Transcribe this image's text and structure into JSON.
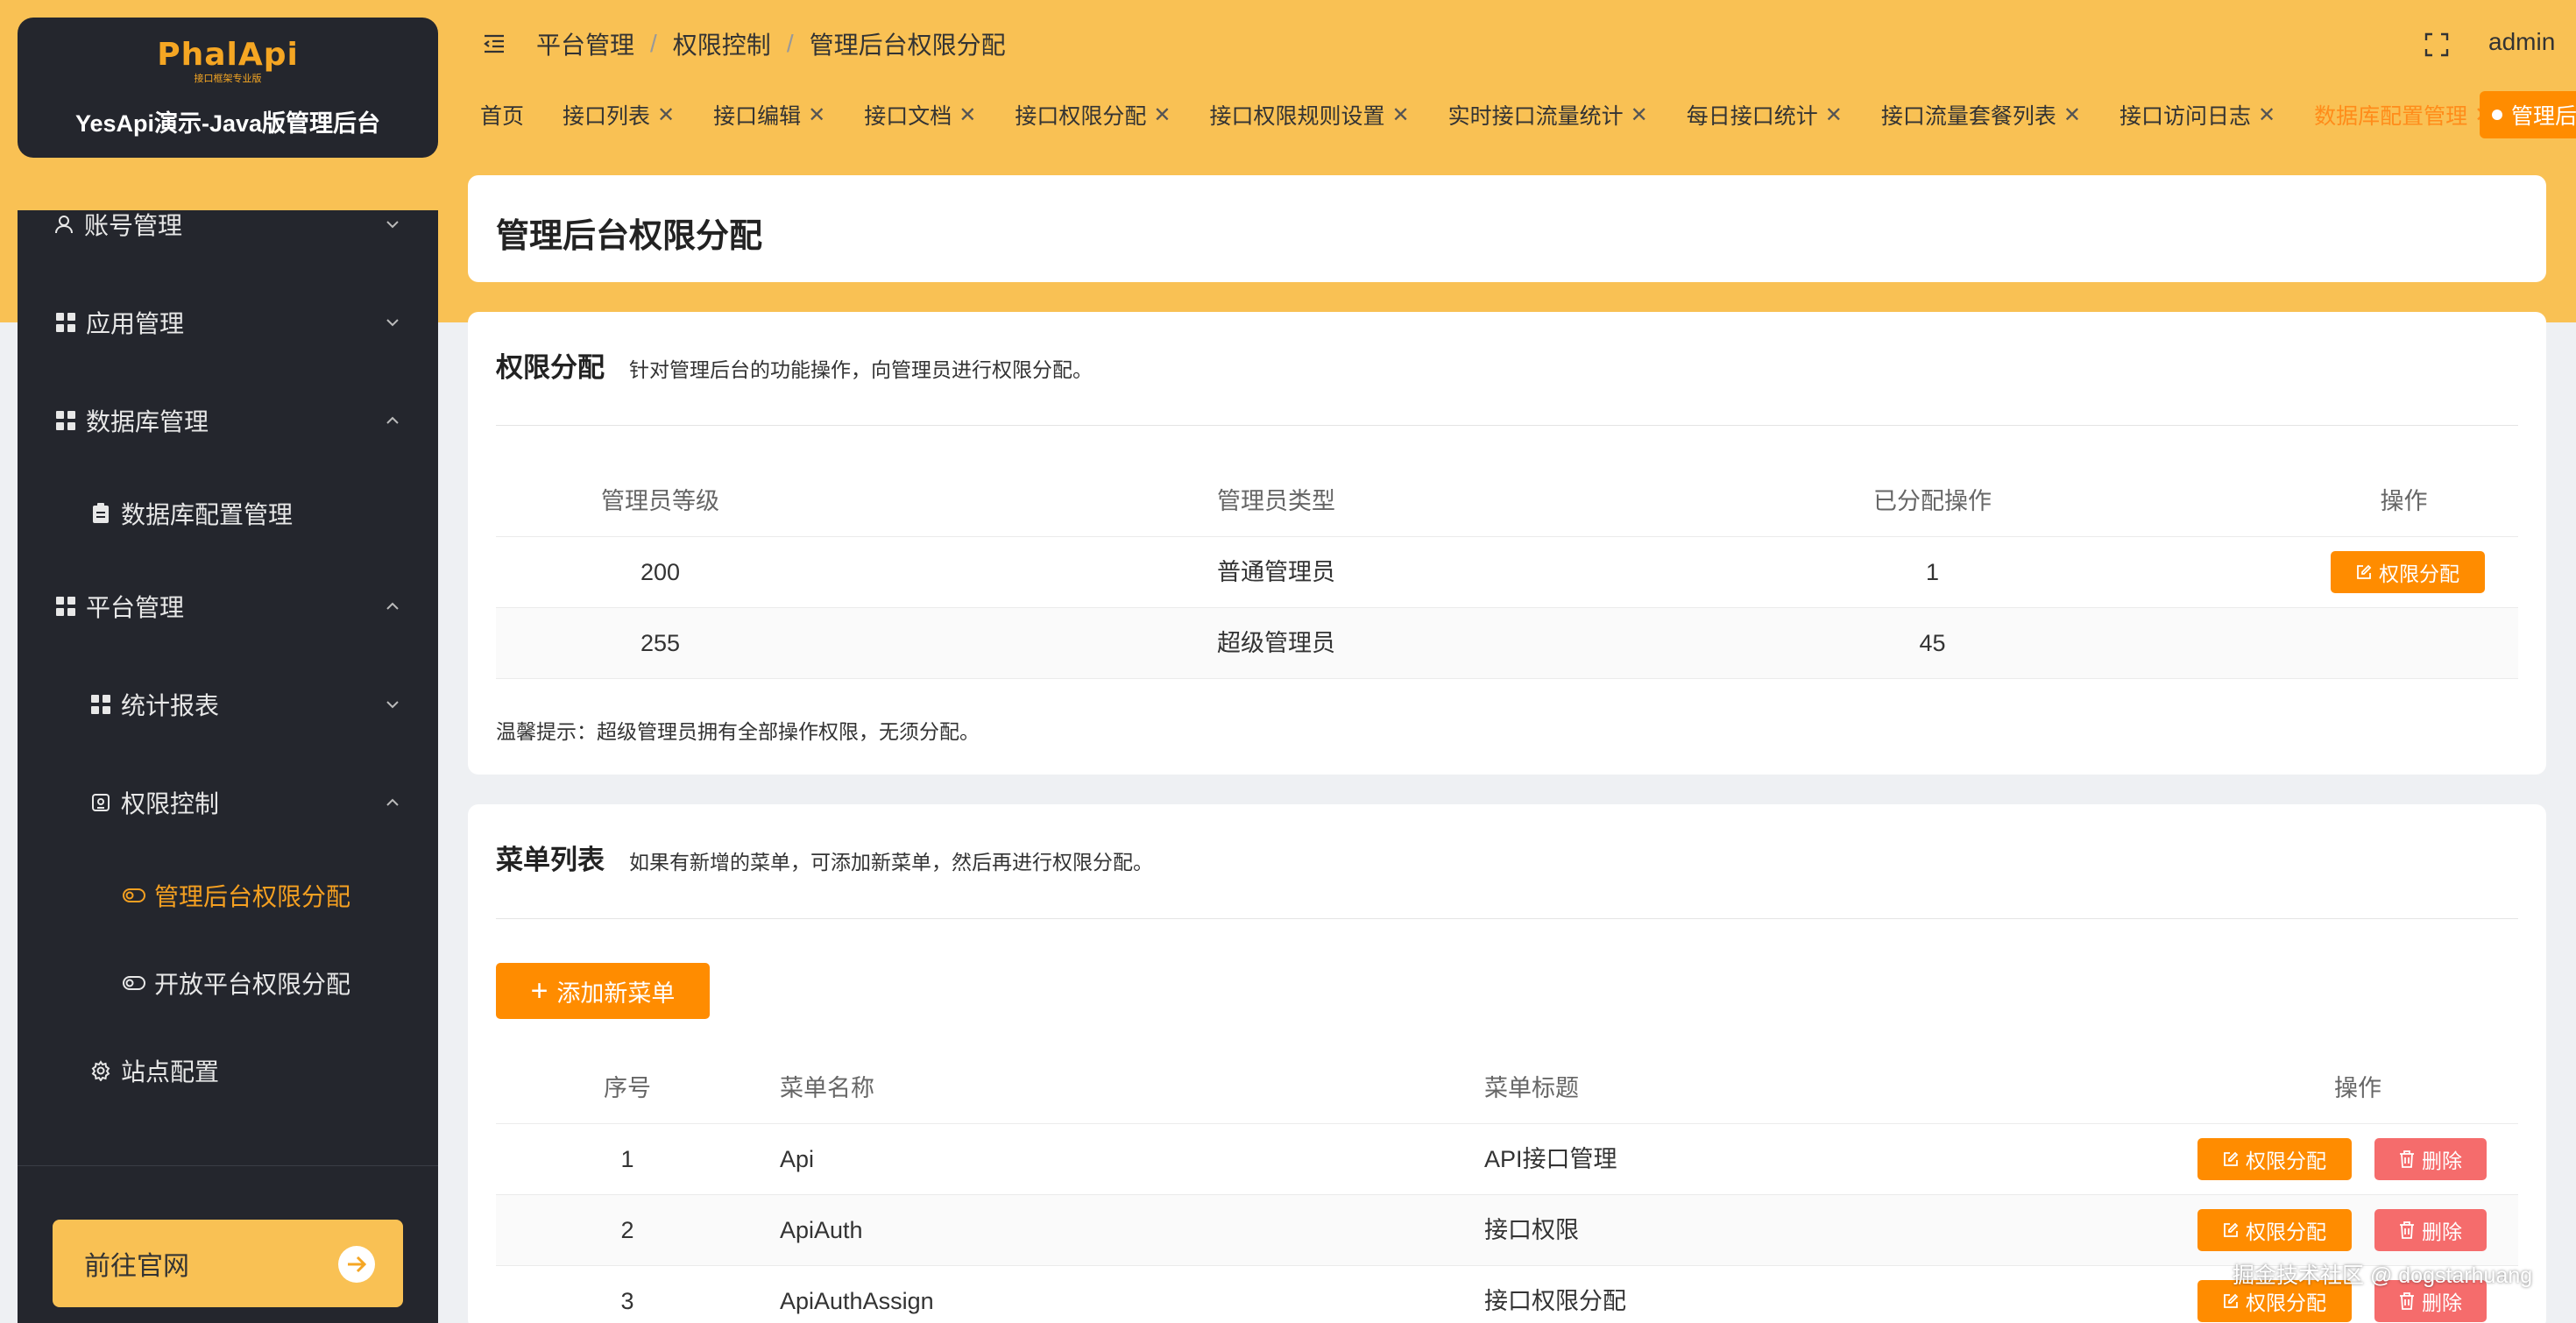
{
  "app": {
    "logo_text": "PhalApi",
    "logo_sub": "接口框架专业版",
    "title": "YesApi演示-Java版管理后台"
  },
  "sidebar": {
    "items": [
      {
        "label": "账号管理",
        "icon": "user-icon",
        "state": "collapsed"
      },
      {
        "label": "应用管理",
        "icon": "grid-icon",
        "state": "collapsed"
      },
      {
        "label": "数据库管理",
        "icon": "grid-icon",
        "state": "expanded"
      },
      {
        "label": "数据库配置管理",
        "icon": "clipboard-icon"
      },
      {
        "label": "平台管理",
        "icon": "grid-icon",
        "state": "expanded"
      },
      {
        "label": "统计报表",
        "icon": "grid-icon",
        "state": "collapsed"
      },
      {
        "label": "权限控制",
        "icon": "lock-icon",
        "state": "expanded"
      },
      {
        "label": "管理后台权限分配",
        "icon": "toggle-icon",
        "active": true
      },
      {
        "label": "开放平台权限分配",
        "icon": "toggle-icon"
      },
      {
        "label": "站点配置",
        "icon": "gear-icon"
      }
    ],
    "go_site_label": "前往官网"
  },
  "header": {
    "breadcrumb": [
      "平台管理",
      "权限控制",
      "管理后台权限分配"
    ],
    "username": "admin"
  },
  "tabs": [
    {
      "label": "首页",
      "closable": false
    },
    {
      "label": "接口列表",
      "closable": true
    },
    {
      "label": "接口编辑",
      "closable": true
    },
    {
      "label": "接口文档",
      "closable": true
    },
    {
      "label": "接口权限分配",
      "closable": true
    },
    {
      "label": "接口权限规则设置",
      "closable": true
    },
    {
      "label": "实时接口流量统计",
      "closable": true
    },
    {
      "label": "每日接口统计",
      "closable": true
    },
    {
      "label": "接口流量套餐列表",
      "closable": true
    },
    {
      "label": "接口访问日志",
      "closable": true
    },
    {
      "label": "数据库配置管理",
      "closable": true,
      "highlight": true
    }
  ],
  "current_tab": "管理后台",
  "page_title": "管理后台权限分配",
  "perm_section": {
    "title": "权限分配",
    "desc": "针对管理后台的功能操作，向管理员进行权限分配。",
    "columns": [
      "管理员等级",
      "管理员类型",
      "已分配操作",
      "操作"
    ],
    "rows": [
      {
        "level": "200",
        "type": "普通管理员",
        "ops": "1",
        "has_action": true
      },
      {
        "level": "255",
        "type": "超级管理员",
        "ops": "45",
        "has_action": false
      }
    ],
    "action_label": "权限分配",
    "tip": "温馨提示：超级管理员拥有全部操作权限，无须分配。"
  },
  "menu_section": {
    "title": "菜单列表",
    "desc": "如果有新增的菜单，可添加新菜单，然后再进行权限分配。",
    "add_label": "添加新菜单",
    "columns": [
      "序号",
      "菜单名称",
      "菜单标题",
      "操作"
    ],
    "rows": [
      {
        "no": "1",
        "name": "Api",
        "title": "API接口管理"
      },
      {
        "no": "2",
        "name": "ApiAuth",
        "title": "接口权限"
      },
      {
        "no": "3",
        "name": "ApiAuthAssign",
        "title": "接口权限分配"
      }
    ],
    "perm_label": "权限分配",
    "delete_label": "删除"
  },
  "watermark": "掘金技术社区 @ dogstarhuang",
  "colors": {
    "accent": "#ff8c00",
    "header_bg": "#f9c154",
    "sidebar_bg": "#24262d",
    "danger": "#f56c6c",
    "active_menu": "#f5a021"
  }
}
